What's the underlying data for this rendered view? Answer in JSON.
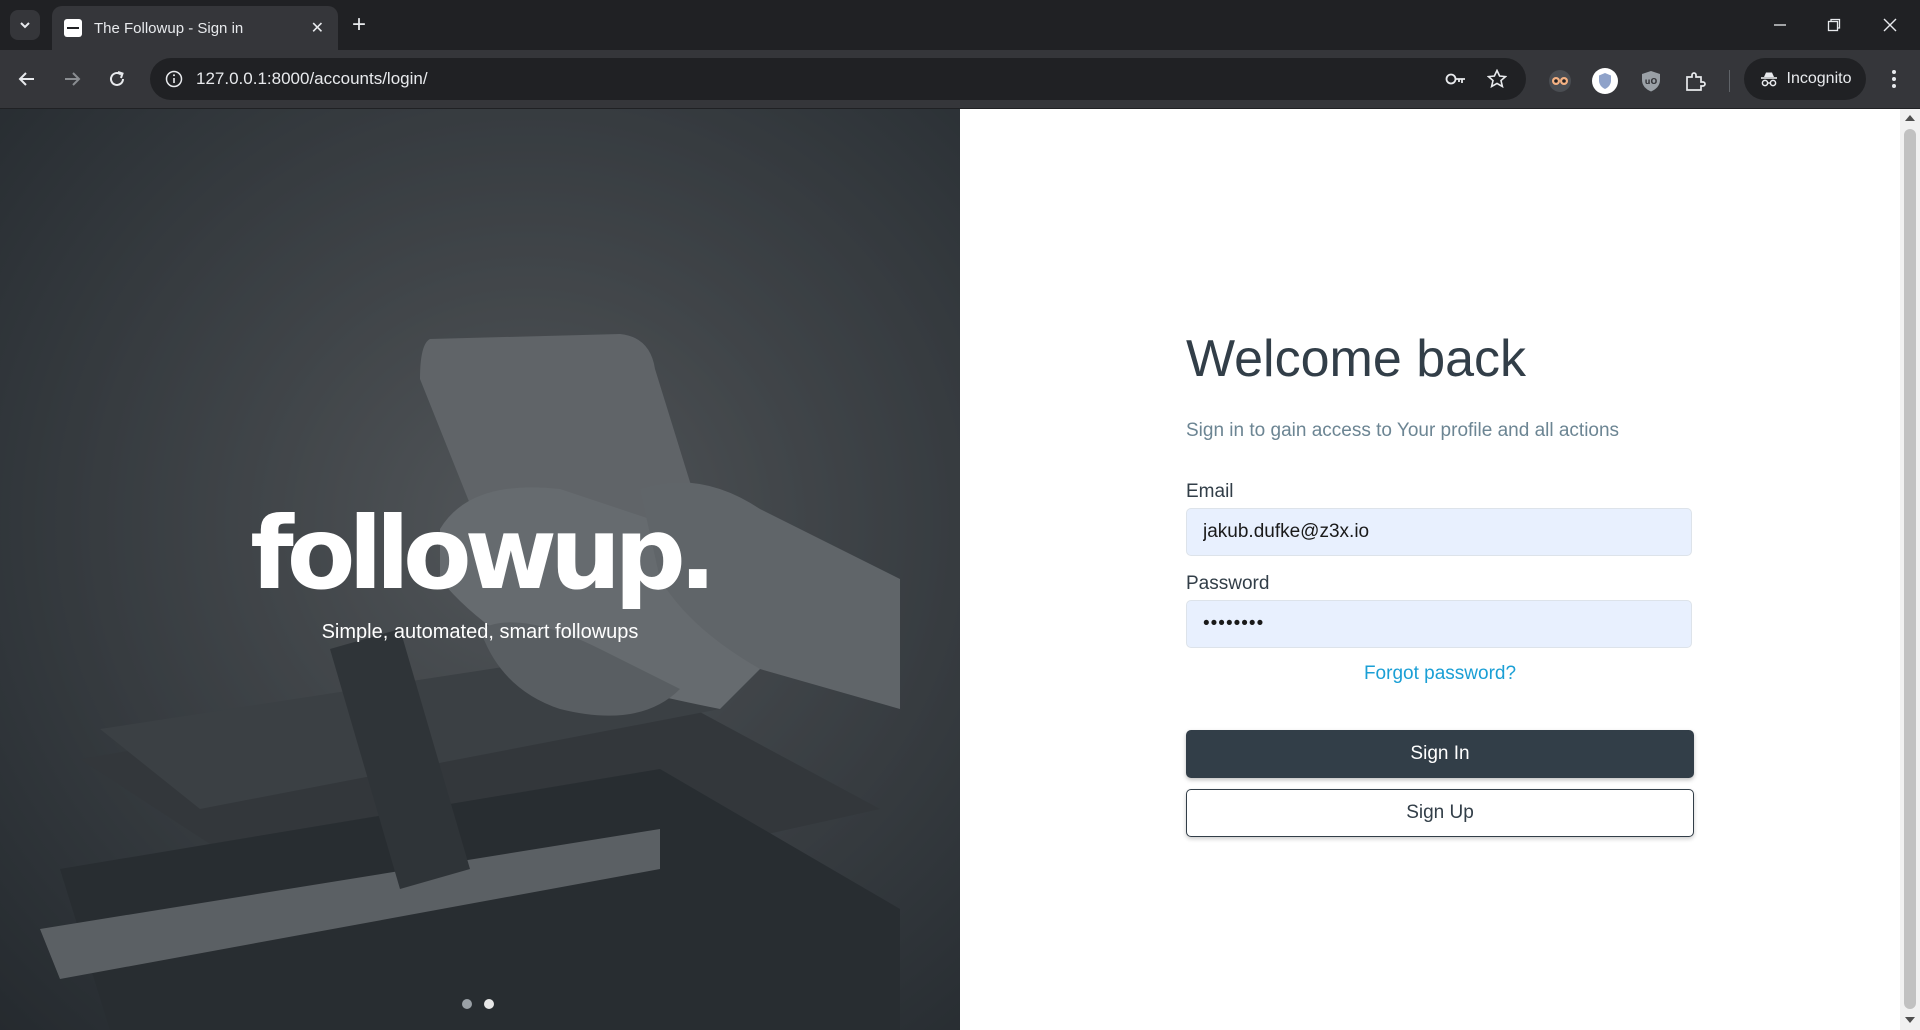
{
  "browser": {
    "tab": {
      "title": "The Followup - Sign in",
      "close": "✕"
    },
    "new_tab": "+",
    "url": "127.0.0.1:8000/accounts/login/",
    "incognito_label": "Incognito"
  },
  "hero": {
    "brand": "followup.",
    "tagline": "Simple, automated, smart followups",
    "carousel": {
      "count": 2,
      "active_index": 1
    }
  },
  "form": {
    "heading": "Welcome back",
    "subtitle": "Sign in to gain access to Your profile and all actions",
    "email": {
      "label": "Email",
      "value": "jakub.dufke@z3x.io"
    },
    "password": {
      "label": "Password",
      "value": "••••••••"
    },
    "forgot_label": "Forgot password?",
    "sign_in_label": "Sign In",
    "sign_up_label": "Sign Up"
  },
  "colors": {
    "primary": "#323e48",
    "link": "#1a9fd5",
    "autofill": "#e8f0fe",
    "subtitle": "#6c8593"
  }
}
